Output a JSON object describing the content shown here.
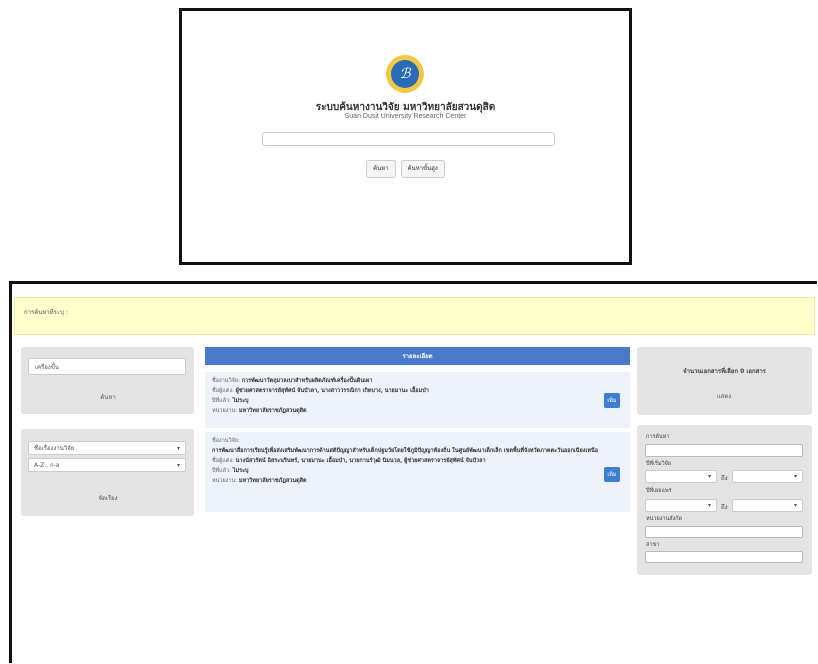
{
  "top": {
    "logo_glyph": "ℬ",
    "title": "ระบบค้นหางานวิจัย มหาวิทยาลัยสวนดุสิต",
    "subtitle": "Suan Dusit University Research Center",
    "search_value": "",
    "search_button": "ค้นหา",
    "advanced_button": "ค้นหาขั้นสูง"
  },
  "notice": {
    "text": "การค้นหาที่ระบุ :"
  },
  "keyword": {
    "placeholder": "เครื่องขึ้น",
    "search_button": "ค้นหา"
  },
  "sort": {
    "field_value": "ชื่อเรื่องงานวิจัย",
    "order_value": "A-Z , ก-ฮ",
    "button": "จัดเรียง"
  },
  "results": {
    "header": "รายละเอียด",
    "add_label": "เพิ่ม",
    "items": [
      {
        "title_label": "ชื่องานวิจัย:",
        "title_value": "การพัฒนาวัตถุมวลเบาสำหรับผลิตภัณฑ์เครื่องปั้นดินเผา",
        "author_label": "ชื่อผู้แต่ง:",
        "author_value": "ผู้ช่วยศาสตราจารย์สุทัศน์ จันบัวลา, นางสาววรรณิกา เกิดบาง, นายมานะ เอื้อมบำ",
        "year_label": "ปีที่แล้ว:",
        "year_value": "ไม่ระบุ",
        "org_label": "หน่วยงาน:",
        "org_value": "มหาวิทยาลัยราชภัฏสวนดุสิต"
      },
      {
        "title_label": "ชื่องานวิจัย:",
        "title_value": "การพัฒนาสื่อการเรียนรู้เพื่อส่งเสริมพัฒนาการด้านสติปัญญาสำหรับเด็กปฐมวัยโดยใช้ภูมิปัญญาท้องถิ่น ในศูนย์พัฒนาเด็กเล็ก เขตพื้นที่จังหวัดภาคตะวันออกเฉียงเหนือ",
        "author_label": "ชื่อผู้แต่ง:",
        "author_value": "นางนัสวรัตน์ อิสระนรินทร์, นายมานะ เอื้อมบำ, นายกานร์วุฒิ นิมนวล, ผู้ช่วยศาสตราจารย์สุทัศน์ จันบัวลา",
        "year_label": "ปีที่แล้ว:",
        "year_value": "ไม่ระบุ",
        "org_label": "หน่วยงาน:",
        "org_value": "มหาวิทยาลัยราชภัฏสวนดุสิต"
      }
    ]
  },
  "selection": {
    "label": "จำนวนเอกสารที่เลือก 0 เอกสาร",
    "show_button": "แสดง"
  },
  "advanced": {
    "search_label": "การค้นหา",
    "year_start_label": "ปีที่เริ่มวิจัย",
    "year_end_label": "ปีที่เผยแพร่",
    "to_label": "ถึง",
    "dept_label": "หน่วยงานสังกัด",
    "branch_label": "สาขา"
  },
  "colors": {
    "accent": "#4a79cc",
    "notice_bg": "#ffffcc",
    "panel_bg": "#e3e3e3"
  }
}
